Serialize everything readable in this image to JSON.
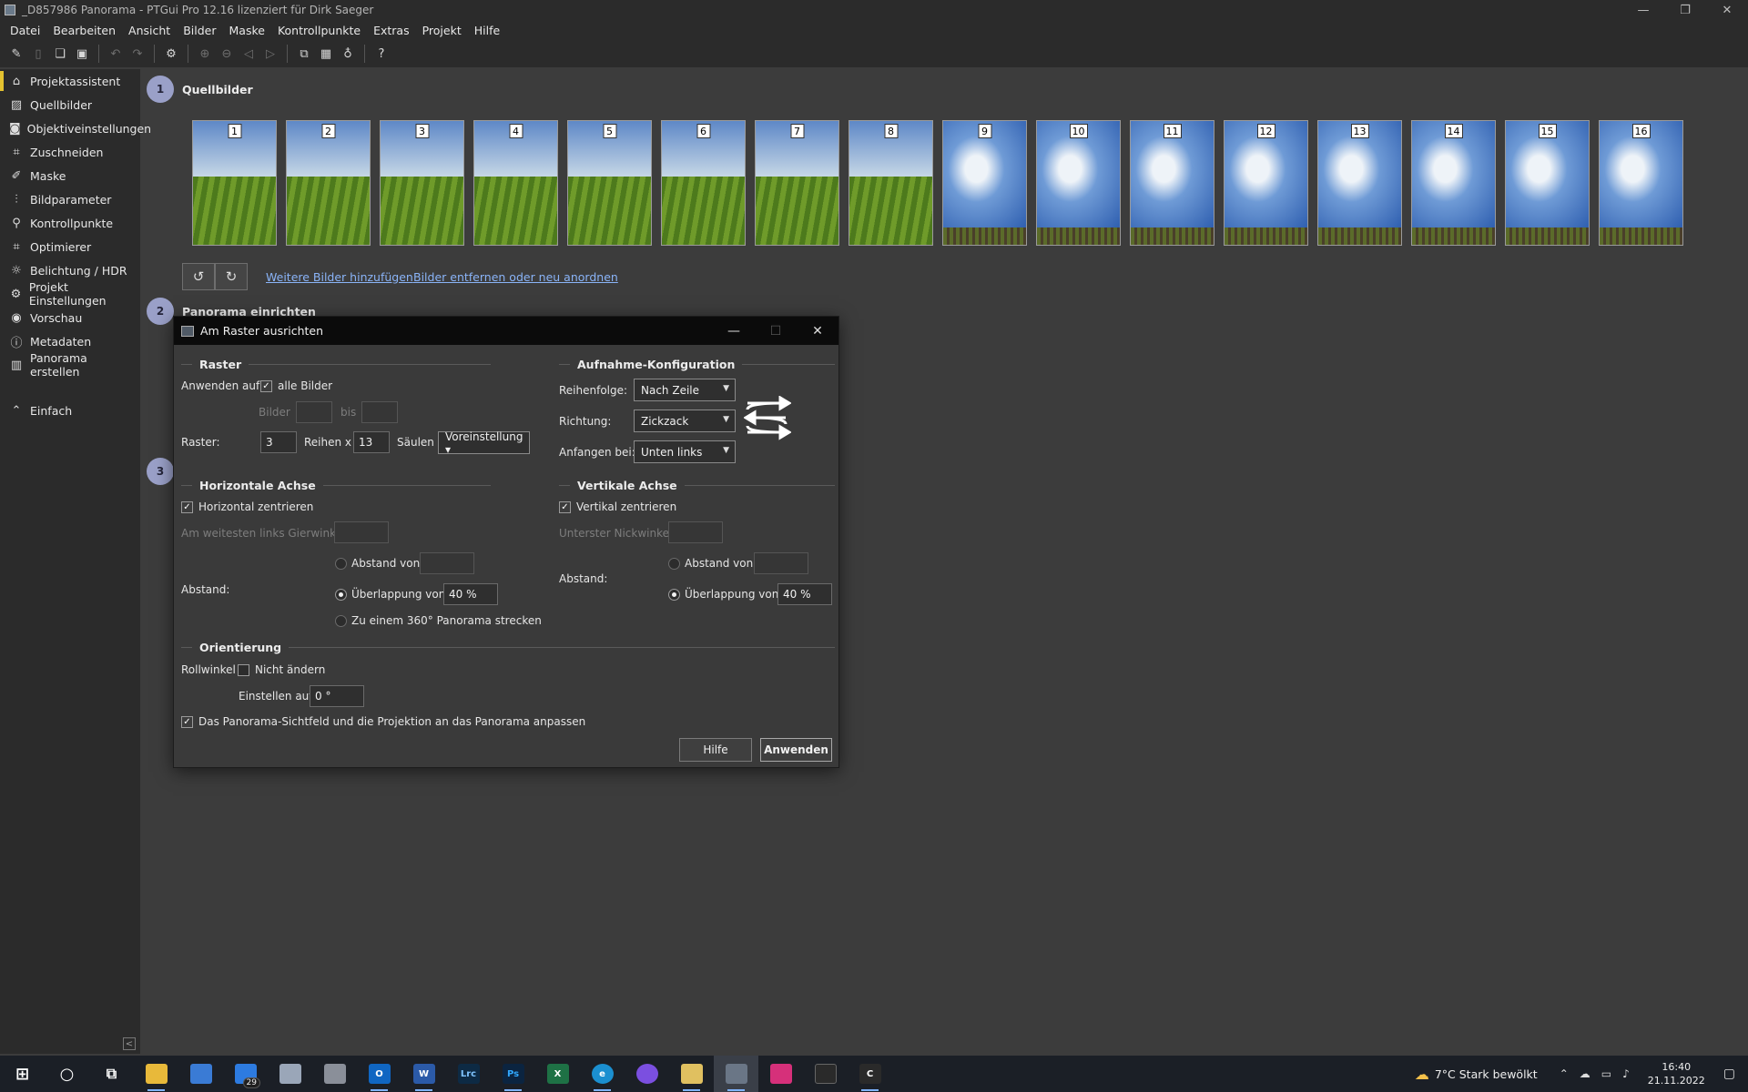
{
  "window": {
    "title": "_D857986 Panorama - PTGui Pro 12.16 lizenziert für Dirk Saeger",
    "controls": [
      "—",
      "❐",
      "✕"
    ]
  },
  "menu": [
    "Datei",
    "Bearbeiten",
    "Ansicht",
    "Bilder",
    "Maske",
    "Kontrollpunkte",
    "Extras",
    "Projekt",
    "Hilfe"
  ],
  "sidebar": {
    "items": [
      {
        "label": "Projektassistent",
        "icon": "home-icon"
      },
      {
        "label": "Quellbilder",
        "icon": "image-icon"
      },
      {
        "label": "Objektiveinstellungen",
        "icon": "camera-icon"
      },
      {
        "label": "Zuschneiden",
        "icon": "crop-icon"
      },
      {
        "label": "Maske",
        "icon": "brush-icon"
      },
      {
        "label": "Bildparameter",
        "icon": "sliders-icon"
      },
      {
        "label": "Kontrollpunkte",
        "icon": "control-points-icon"
      },
      {
        "label": "Optimierer",
        "icon": "optimizer-icon"
      },
      {
        "label": "Belichtung / HDR",
        "icon": "sun-icon"
      },
      {
        "label": "Projekt Einstellungen",
        "icon": "gear-icon"
      },
      {
        "label": "Vorschau",
        "icon": "eye-icon"
      },
      {
        "label": "Metadaten",
        "icon": "info-icon"
      },
      {
        "label": "Panorama erstellen",
        "icon": "panorama-icon"
      }
    ],
    "simple_label": "Einfach"
  },
  "main": {
    "step1": {
      "num": "1",
      "title": "Quellbilder"
    },
    "step2": {
      "num": "2",
      "title": "Panorama einrichten"
    },
    "step3": {
      "num": "3"
    },
    "thumbnails": [
      "1",
      "2",
      "3",
      "4",
      "5",
      "6",
      "7",
      "8",
      "9",
      "10",
      "11",
      "12",
      "13",
      "14",
      "15",
      "16"
    ],
    "link_add": "Weitere Bilder hinzufügen",
    "link_remove": "Bilder entfernen oder neu anordnen"
  },
  "dialog": {
    "title": "Am Raster ausrichten",
    "raster": {
      "heading": "Raster",
      "apply_label": "Anwenden auf:",
      "all_images_label": "alle Bilder",
      "all_images_checked": true,
      "images_label": "Bilder",
      "from_value": "",
      "to_label": "bis",
      "to_value": "",
      "grid_label": "Raster:",
      "rows_value": "3",
      "rows_label": "Reihen x",
      "cols_value": "13",
      "cols_label": "Säulen",
      "preset_label": "Voreinstellung ▾"
    },
    "capture": {
      "heading": "Aufnahme-Konfiguration",
      "order_label": "Reihenfolge:",
      "order_value": "Nach Zeile",
      "direction_label": "Richtung:",
      "direction_value": "Zickzack",
      "start_label": "Anfangen bei:",
      "start_value": "Unten links"
    },
    "horizontal": {
      "heading": "Horizontale Achse",
      "center_label": "Horizontal zentrieren",
      "center_checked": true,
      "leftmost_label": "Am weitesten links Gierwinkel:",
      "leftmost_value": "",
      "spacing_label": "Abstand:",
      "distance_label": "Abstand von",
      "distance_value": "",
      "overlap_label": "Überlappung von",
      "overlap_value": "40 %",
      "stretch_label": "Zu einem 360° Panorama strecken"
    },
    "vertical": {
      "heading": "Vertikale Achse",
      "center_label": "Vertikal zentrieren",
      "center_checked": true,
      "lowest_label": "Unterster Nickwinkel:",
      "lowest_value": "",
      "spacing_label": "Abstand:",
      "distance_label": "Abstand von",
      "distance_value": "",
      "overlap_label": "Überlappung von",
      "overlap_value": "40 %"
    },
    "orientation": {
      "heading": "Orientierung",
      "roll_label": "Rollwinkel",
      "no_change_label": "Nicht ändern",
      "no_change_checked": false,
      "set_to_label": "Einstellen auf",
      "set_to_value": "0 °"
    },
    "fit_label": "Das Panorama-Sichtfeld und die Projektion an das Panorama anpassen",
    "fit_checked": true,
    "help_button": "Hilfe",
    "apply_button": "Anwenden"
  },
  "taskbar": {
    "apps": [
      {
        "name": "start-icon",
        "text": "⊞",
        "color": "#1b1f26"
      },
      {
        "name": "search-icon",
        "text": "○",
        "color": "#1b1f26"
      },
      {
        "name": "task-view-icon",
        "text": "⧉",
        "color": "#1b1f26"
      },
      {
        "name": "file-explorer-icon",
        "text": "",
        "color": "#e8b93a"
      },
      {
        "name": "store-icon",
        "text": "",
        "color": "#3a7bd5"
      },
      {
        "name": "mail-icon",
        "text": "",
        "color": "#2d7be0",
        "badge": "29"
      },
      {
        "name": "app-icon",
        "text": "",
        "color": "#9aa6b8"
      },
      {
        "name": "calculator-icon",
        "text": "",
        "color": "#8a8f99"
      },
      {
        "name": "outlook-icon",
        "text": "O",
        "color": "#1066c2"
      },
      {
        "name": "word-icon",
        "text": "W",
        "color": "#2b5aa8"
      },
      {
        "name": "lightroom-classic-icon",
        "text": "Lrc",
        "color": "#0d2a44"
      },
      {
        "name": "photoshop-icon",
        "text": "Ps",
        "color": "#0b2440"
      },
      {
        "name": "excel-icon",
        "text": "X",
        "color": "#1e7145"
      },
      {
        "name": "edge-icon",
        "text": "e",
        "color": "#1b8fd0"
      },
      {
        "name": "messenger-icon",
        "text": "",
        "color": "#7b4fe0"
      },
      {
        "name": "app-icon",
        "text": "",
        "color": "#e0c060"
      },
      {
        "name": "ptgui-icon",
        "text": "",
        "color": "#6a7686",
        "active": true
      },
      {
        "name": "instagram-icon",
        "text": "",
        "color": "#d6307a"
      },
      {
        "name": "app-icon",
        "text": "",
        "color": "#2a2a2a"
      },
      {
        "name": "app-icon",
        "text": "C",
        "color": "#2a2a2a"
      }
    ],
    "weather_text": "7°C  Stark bewölkt",
    "time": "16:40",
    "date": "21.11.2022"
  }
}
